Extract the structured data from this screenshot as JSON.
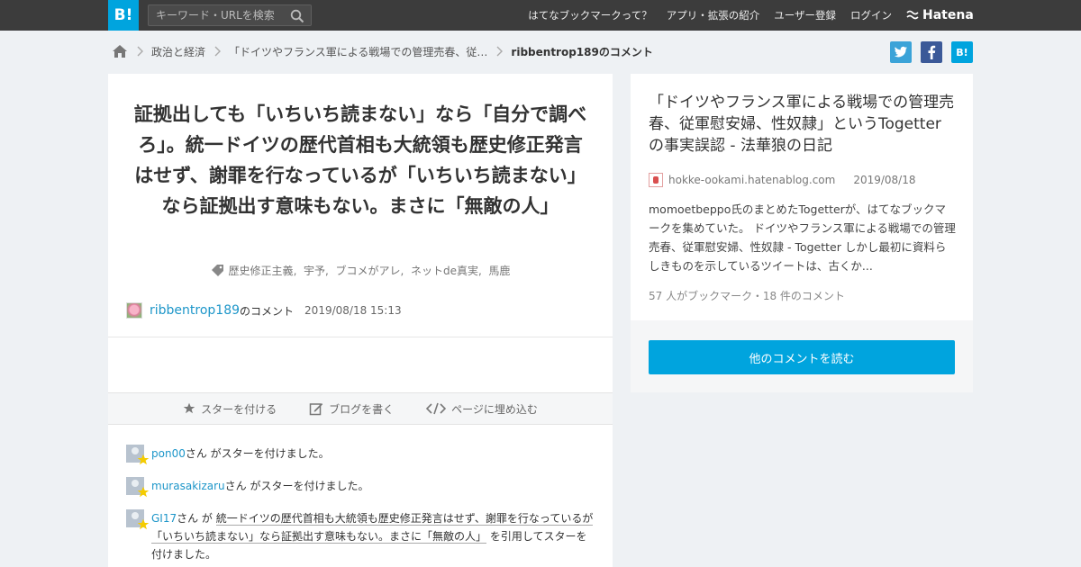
{
  "header": {
    "logo": "B!",
    "search_placeholder": "キーワード・URLを検索",
    "nav": [
      "はてなブックマークって？",
      "アプリ・拡張の紹介",
      "ユーザー登録",
      "ログイン"
    ],
    "hatena": "Hatena"
  },
  "breadcrumb": {
    "items": [
      "政治と経済",
      "「ドイツやフランス軍による戦場での管理売春、従…",
      "ribbentrop189のコメント"
    ]
  },
  "share": {
    "hatena": "B!"
  },
  "comment": {
    "headline": "証拠出しても「いちいち読まない」なら「自分で調べろ」。統一ドイツの歴代首相も大統領も歴史修正発言はせず、謝罪を行なっているが「いちいち読まない」なら証拠出す意味もない。まさに「無敵の人」",
    "tags": [
      "歴史修正主義",
      "宇予",
      "ブコメがアレ",
      "ネットde真実",
      "馬鹿"
    ],
    "author": "ribbentrop189",
    "author_suffix": "のコメント",
    "timestamp": "2019/08/18 15:13"
  },
  "actions": [
    "スターを付ける",
    "ブログを書く",
    "ページに埋め込む"
  ],
  "stars": [
    {
      "user": "pon00",
      "text": "さん がスターを付けました。"
    },
    {
      "user": "murasakizaru",
      "text": "さん がスターを付けました。"
    },
    {
      "user": "GI17",
      "prefix": "さん が ",
      "quote": "統一ドイツの歴代首相も大統領も歴史修正発言はせず、謝罪を行なっているが「いちいち読まない」なら証拠出す意味もない。まさに「無敵の人」",
      "suffix": " を引用してスターを付けました。"
    }
  ],
  "article": {
    "title": "「ドイツやフランス軍による戦場での管理売春、従軍慰安婦、性奴隷」というTogetterの事実誤認 - 法華狼の日記",
    "domain": "hokke-ookami.hatenablog.com",
    "date": "2019/08/18",
    "description": "momoetbeppo氏のまとめたTogetterが、はてなブックマークを集めていた。 ドイツやフランス軍による戦場での管理売春、従軍慰安婦、性奴隷 - Togetter しかし最初に資料らしきものを示しているツイートは、古くか...",
    "stats": "57 人がブックマーク・18 件のコメント",
    "more_button": "他のコメントを読む"
  },
  "colors": {
    "accent": "#00a4de",
    "topbar": "#3c3c3c",
    "link": "#1d96c9"
  }
}
